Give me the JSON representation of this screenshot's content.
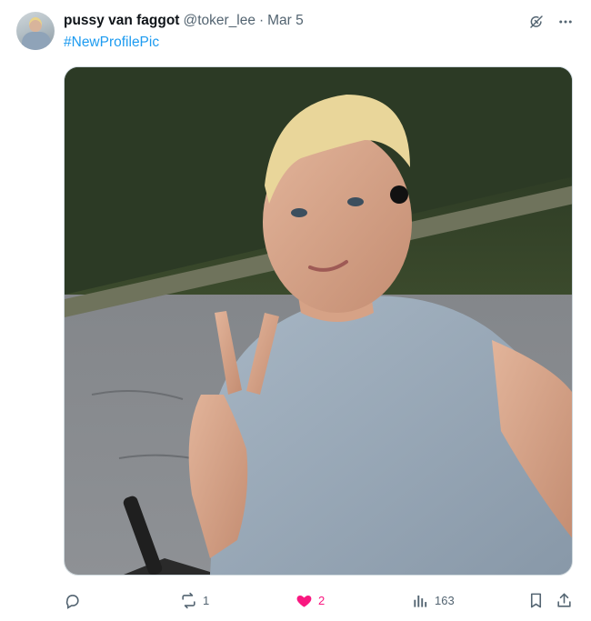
{
  "tweet": {
    "display_name": "pussy van faggot",
    "handle": "@toker_lee",
    "separator": "·",
    "date": "Mar 5",
    "text": "#NewProfilePic",
    "top_icons": [
      "grok-icon",
      "more-icon"
    ],
    "media": {
      "description_icon": "photo"
    }
  },
  "actions": {
    "reply_count": "",
    "retweet_count": "1",
    "like_count": "2",
    "views_count": "163"
  },
  "colors": {
    "link": "#1d9bf0",
    "muted": "#536471",
    "like": "#f91880"
  }
}
